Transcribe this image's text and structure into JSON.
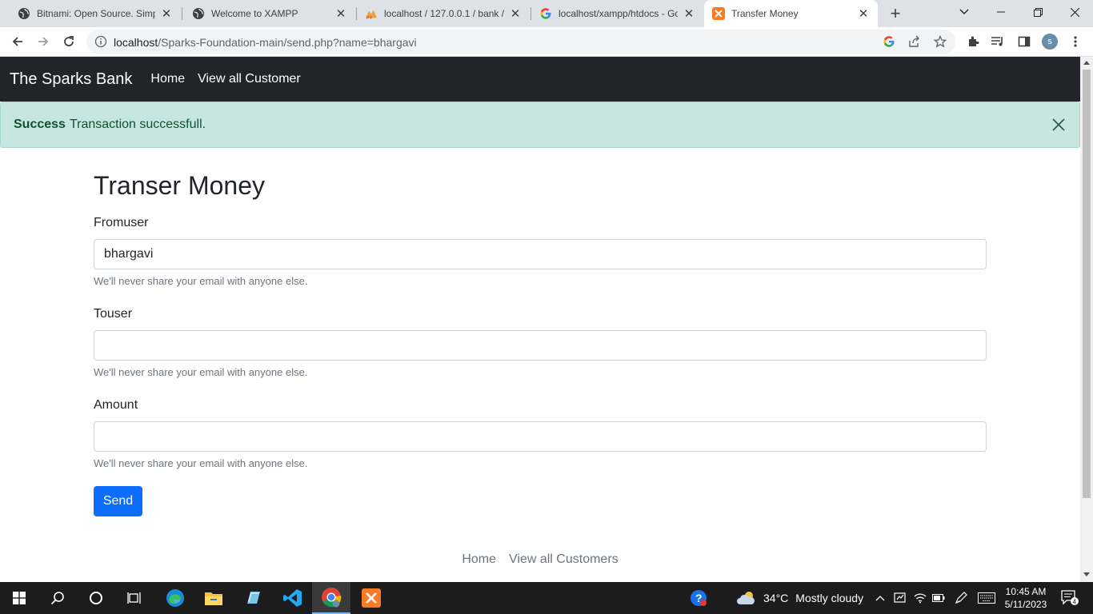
{
  "browser": {
    "tabs": [
      {
        "title": "Bitnami: Open Source. Simplified",
        "icon": "globe-icon"
      },
      {
        "title": "Welcome to XAMPP",
        "icon": "globe-icon"
      },
      {
        "title": "localhost / 127.0.0.1 / bank / ",
        "icon": "phpmyadmin-icon"
      },
      {
        "title": "localhost/xampp/htdocs - Google Search",
        "icon": "google-icon"
      },
      {
        "title": "Transfer Money",
        "icon": "xampp-icon"
      }
    ],
    "url_host": "localhost",
    "url_path": "/Sparks-Foundation-main/send.php?name=bhargavi",
    "profile_initial": "s"
  },
  "navbar": {
    "brand": "The Sparks Bank",
    "links": [
      "Home",
      "View all Customer"
    ]
  },
  "alert": {
    "strong": "Success",
    "message": "Transaction successfull."
  },
  "form": {
    "title": "Transer Money",
    "fields": [
      {
        "label": "Fromuser",
        "value": "bhargavi",
        "help": "We'll never share your email with anyone else."
      },
      {
        "label": "Touser",
        "value": "",
        "help": "We'll never share your email with anyone else."
      },
      {
        "label": "Amount",
        "value": "",
        "help": "We'll never share your email with anyone else."
      }
    ],
    "submit_label": "Send"
  },
  "footer": {
    "links": [
      "Home",
      "View all Customers"
    ]
  },
  "taskbar": {
    "weather_temp": "34°C",
    "weather_text": "Mostly cloudy",
    "time": "10:45 AM",
    "date": "5/11/2023",
    "notification_count": "4"
  },
  "colors": {
    "navbar_bg": "#212529",
    "alert_bg": "#c8e6e0",
    "alert_text": "#0f5132",
    "button_primary": "#0d6efd",
    "taskbar_bg": "#1c1c1c"
  }
}
